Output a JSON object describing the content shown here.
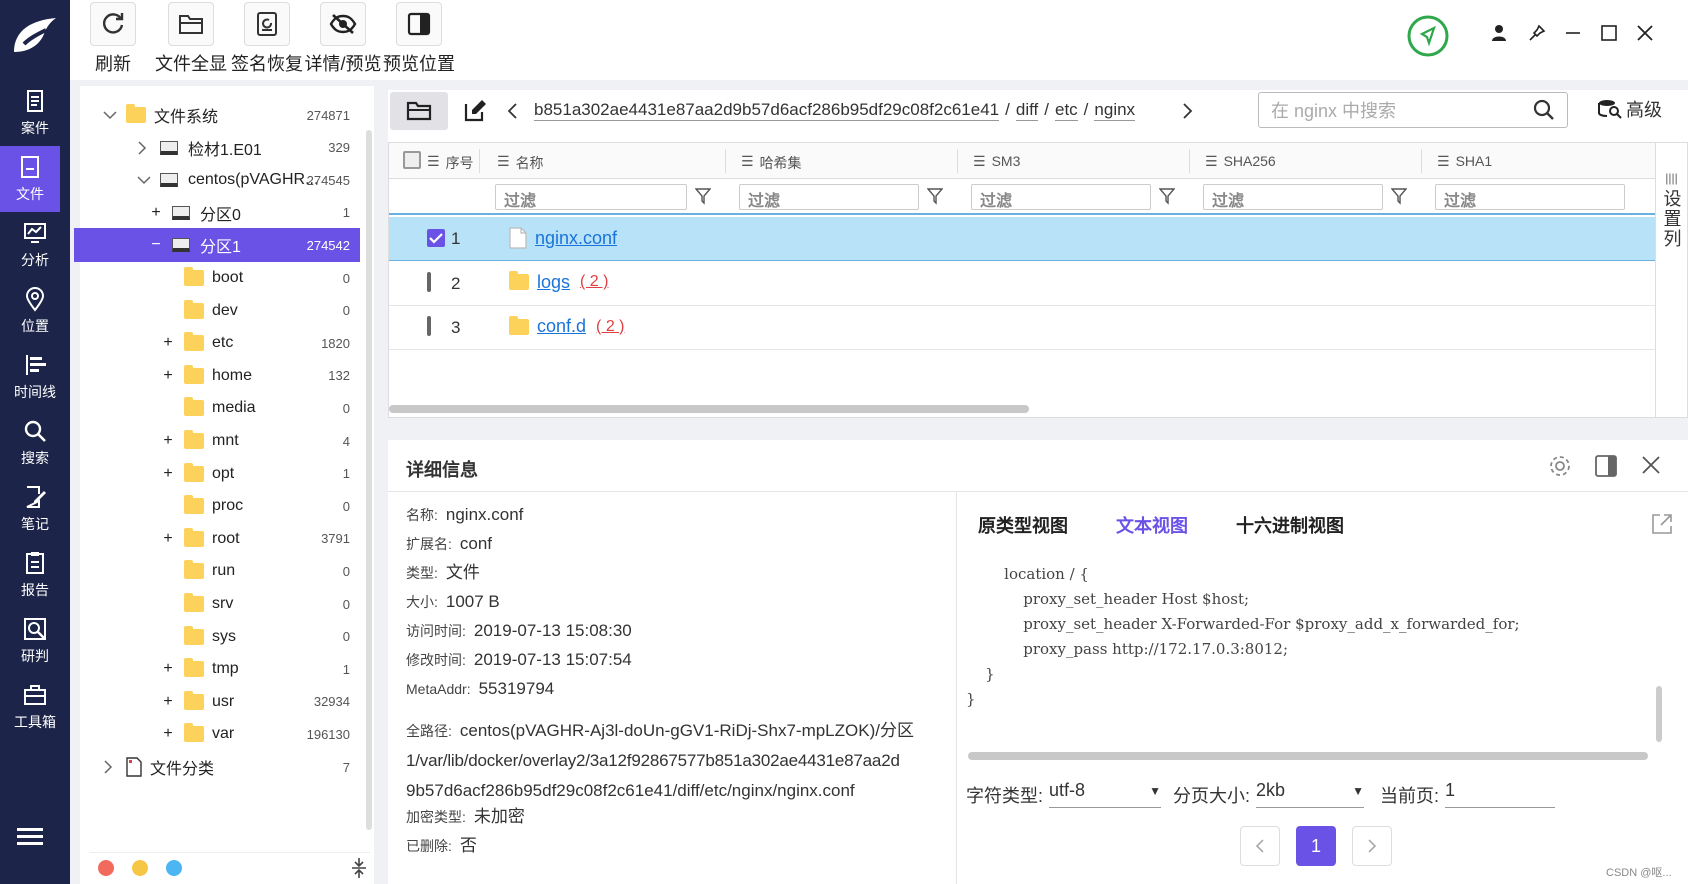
{
  "nav": {
    "items": [
      {
        "label": "案件",
        "icon": "case-icon"
      },
      {
        "label": "文件",
        "icon": "file-icon",
        "active": true
      },
      {
        "label": "分析",
        "icon": "analysis-icon"
      },
      {
        "label": "位置",
        "icon": "location-icon"
      },
      {
        "label": "时间线",
        "icon": "timeline-icon"
      },
      {
        "label": "搜索",
        "icon": "search-icon"
      },
      {
        "label": "笔记",
        "icon": "notes-icon"
      },
      {
        "label": "报告",
        "icon": "report-icon"
      },
      {
        "label": "研判",
        "icon": "judge-icon"
      },
      {
        "label": "工具箱",
        "icon": "toolbox-icon"
      }
    ],
    "menu_icon": "menu-icon"
  },
  "toolbar": {
    "refresh": "刷新",
    "overview": "文件全显",
    "sig_recover": "签名恢复",
    "detail_preview": "详情/预览",
    "preview_pos": "预览位置"
  },
  "tree": {
    "items": [
      {
        "label": "文件系统",
        "count": "274871",
        "level": 0,
        "exp": "v",
        "type": "folder"
      },
      {
        "label": "检材1.E01",
        "count": "329",
        "level": 1,
        "exp": ">",
        "type": "disk"
      },
      {
        "label": "centos(pVAGHR...",
        "count": "274545",
        "level": 1,
        "exp": "v",
        "type": "disk"
      },
      {
        "label": "分区0",
        "count": "1",
        "level": 2,
        "exp": "+",
        "type": "disk"
      },
      {
        "label": "分区1",
        "count": "274542",
        "level": 2,
        "exp": "−",
        "type": "disk",
        "selected": true
      },
      {
        "label": "boot",
        "count": "0",
        "level": 3,
        "exp": "",
        "type": "folder"
      },
      {
        "label": "dev",
        "count": "0",
        "level": 3,
        "exp": "",
        "type": "folder"
      },
      {
        "label": "etc",
        "count": "1820",
        "level": 3,
        "exp": "+",
        "type": "folder"
      },
      {
        "label": "home",
        "count": "132",
        "level": 3,
        "exp": "+",
        "type": "folder"
      },
      {
        "label": "media",
        "count": "0",
        "level": 3,
        "exp": "",
        "type": "folder"
      },
      {
        "label": "mnt",
        "count": "4",
        "level": 3,
        "exp": "+",
        "type": "folder"
      },
      {
        "label": "opt",
        "count": "1",
        "level": 3,
        "exp": "+",
        "type": "folder"
      },
      {
        "label": "proc",
        "count": "0",
        "level": 3,
        "exp": "",
        "type": "folder"
      },
      {
        "label": "root",
        "count": "3791",
        "level": 3,
        "exp": "+",
        "type": "folder"
      },
      {
        "label": "run",
        "count": "0",
        "level": 3,
        "exp": "",
        "type": "folder"
      },
      {
        "label": "srv",
        "count": "0",
        "level": 3,
        "exp": "",
        "type": "folder"
      },
      {
        "label": "sys",
        "count": "0",
        "level": 3,
        "exp": "",
        "type": "folder"
      },
      {
        "label": "tmp",
        "count": "1",
        "level": 3,
        "exp": "+",
        "type": "folder"
      },
      {
        "label": "usr",
        "count": "32934",
        "level": 3,
        "exp": "+",
        "type": "folder"
      },
      {
        "label": "var",
        "count": "196130",
        "level": 3,
        "exp": "+",
        "type": "folder"
      },
      {
        "label": "文件分类",
        "count": "7",
        "level": 0,
        "exp": ">",
        "type": "doc"
      }
    ]
  },
  "path": {
    "segments": [
      "b851a302ae4431e87aa2d9b57d6acf286b95df29c08f2c61e41",
      "diff",
      "etc",
      "nginx"
    ],
    "sep": "/",
    "search_placeholder": "在 nginx 中搜索",
    "advanced": "高级"
  },
  "grid": {
    "columns": [
      "序号",
      "名称",
      "哈希集",
      "SM3",
      "SHA256",
      "SHA1"
    ],
    "filter_placeholder": "过滤",
    "settings_col": "设置列",
    "rows": [
      {
        "idx": "1",
        "name": "nginx.conf",
        "count": "",
        "type": "file",
        "checked": true
      },
      {
        "idx": "2",
        "name": "logs",
        "count": "( 2 )",
        "type": "folder",
        "checked": false
      },
      {
        "idx": "3",
        "name": "conf.d",
        "count": "( 2 )",
        "type": "folder",
        "checked": false
      }
    ]
  },
  "detail": {
    "title": "详细信息",
    "fields": [
      {
        "k": "名称:",
        "v": "nginx.conf"
      },
      {
        "k": "扩展名:",
        "v": "conf"
      },
      {
        "k": "类型:",
        "v": "文件"
      },
      {
        "k": "大小:",
        "v": "1007 B"
      },
      {
        "k": "访问时间:",
        "v": "2019-07-13 15:08:30"
      },
      {
        "k": "修改时间:",
        "v": "2019-07-13 15:07:54"
      },
      {
        "k": "MetaAddr:",
        "v": "55319794"
      }
    ],
    "fullpath_k": "全路径:",
    "fullpath_l1": "centos(pVAGHR-Aj3l-doUn-gGV1-RiDj-Shx7-mpLZOK)/分区",
    "fullpath_l2": "1/var/lib/docker/overlay2/3a12f92867577b851a302ae4431e87aa2d",
    "fullpath_l3": "9b57d6acf286b95df29c08f2c61e41/diff/etc/nginx/nginx.conf",
    "enc_k": "加密类型:",
    "enc_v": "未加密",
    "del_k": "已删除:",
    "del_v": "否"
  },
  "preview": {
    "tabs": [
      "原类型视图",
      "文本视图",
      "十六进制视图"
    ],
    "active_tab": 1,
    "code_lines": [
      "        location / {",
      "            proxy_set_header Host $host;",
      "            proxy_set_header X-Forwarded-For $proxy_add_x_forwarded_for;",
      "            proxy_pass http://172.17.0.3:8012;",
      "    }",
      "}"
    ],
    "charset_label": "字符类型:",
    "charset_value": "utf-8",
    "pagesize_label": "分页大小:",
    "pagesize_value": "2kb",
    "curpage_label": "当前页:",
    "curpage_value": "1",
    "page_number": "1"
  },
  "watermark": "CSDN @呕...",
  "colors": {
    "accent": "#6a52e6",
    "nav": "#1c2549",
    "selection": "#b8e2f8",
    "link": "#1a73d9"
  }
}
